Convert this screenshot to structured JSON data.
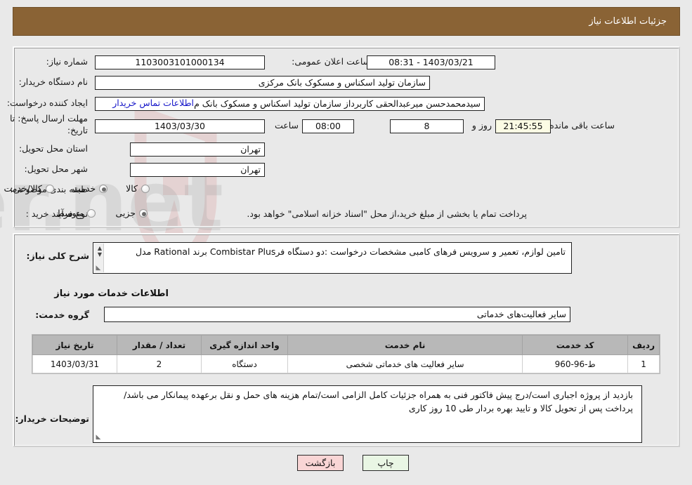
{
  "header": {
    "title": "جزئیات اطلاعات نیاز"
  },
  "form": {
    "need_number_label": "شماره نیاز:",
    "need_number_value": "1103003101000134",
    "announce_label": "تاریخ و ساعت اعلان عمومی:",
    "announce_value": "1403/03/21 - 08:31",
    "buyer_org_label": "نام دستگاه خریدار:",
    "buyer_org_value": "سازمان تولید اسکناس و مسکوک بانک مرکزی",
    "creator_label": "ایجاد کننده درخواست:",
    "creator_value": "سیدمحمدحسن میرعبدالحقی کاربرداز سازمان تولید اسکناس و مسکوک بانک م",
    "contact_link": "اطلاعات تماس خریدار",
    "deadline_label_l1": "مهلت ارسال پاسخ: تا",
    "deadline_label_l2": "تاریخ:",
    "deadline_date": "1403/03/30",
    "deadline_hour_label": "ساعت",
    "deadline_hour": "08:00",
    "remain_days": "8",
    "remain_days_label": "روز و",
    "remain_time": "21:45:55",
    "remain_time_label": "ساعت باقی مانده",
    "province_label": "استان محل تحویل:",
    "province_value": "تهران",
    "city_label": "شهر محل تحویل:",
    "city_value": "تهران",
    "category_label": "طبقه بندی موضوعی:",
    "category_options": [
      {
        "label": "کالا",
        "selected": false
      },
      {
        "label": "خدمت",
        "selected": true
      },
      {
        "label": "کالا/خدمت",
        "selected": false
      }
    ],
    "process_label": "نوع فرآیند خرید :",
    "process_options": [
      {
        "label": "جزیی",
        "selected": true
      },
      {
        "label": "متوسط",
        "selected": false
      }
    ],
    "process_note": "پرداخت تمام یا بخشی از مبلغ خرید،از محل \"اسناد خزانه اسلامی\" خواهد بود."
  },
  "detail": {
    "summary_label": "شرح کلی نیاز:",
    "summary_value": "تامین لوازم، تعمیر و سرویس فرهای کامبی مشخصات درخواست :دو دستگاه فرCombistar Plus برند Rational مدل",
    "services_heading": "اطلاعات خدمات مورد نیاز",
    "service_group_label": "گروه خدمت:",
    "service_group_value": "سایر فعالیت‌های خدماتی"
  },
  "table": {
    "columns": [
      "ردیف",
      "کد خدمت",
      "نام خدمت",
      "واحد اندازه گیری",
      "تعداد / مقدار",
      "تاریخ نیاز"
    ],
    "rows": [
      {
        "index": "1",
        "code": "ط-96-960",
        "name": "سایر فعالیت های خدماتی شخصی",
        "unit": "دستگاه",
        "qty": "2",
        "date": "1403/03/31"
      }
    ]
  },
  "notes": {
    "label": "توضیحات خریدار:",
    "value": "بازدید از پروژه اجباری است/درج پیش فاکتور فنی به همراه جزئیات کامل الزامی است/تمام هزینه های حمل و نقل برعهده پیمانکار می باشد/پرداخت پس از تحویل کالا و تایید بهره بردار طی 10 روز کاری"
  },
  "buttons": {
    "print": "چاپ",
    "back": "بازگشت"
  },
  "watermark": {
    "text": "AriaTender.net"
  },
  "colors": {
    "header_bar": "#8a6335",
    "page_bg": "#e9e9e9",
    "link": "#1414c8",
    "table_header": "#b8b8b8",
    "countdown_bg": "#fbfbe4",
    "print_btn": "#e9f6e4",
    "back_btn": "#f9d5d5"
  }
}
